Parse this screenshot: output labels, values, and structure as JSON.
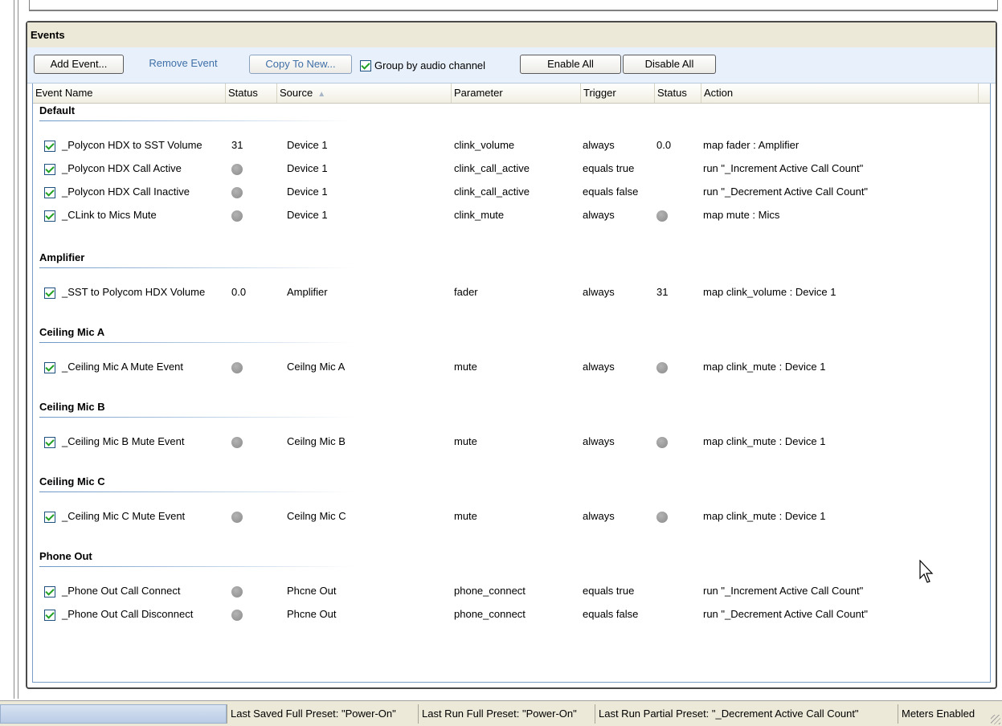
{
  "panel": {
    "title": "Events"
  },
  "toolbar": {
    "add_event": "Add Event...",
    "remove_event": "Remove Event",
    "copy_to_new": "Copy To New...",
    "group_by_audio_channel": "Group by audio channel",
    "enable_all": "Enable All",
    "disable_all": "Disable All"
  },
  "columns": {
    "event_name": "Event Name",
    "status": "Status",
    "source": "Source",
    "parameter": "Parameter",
    "trigger": "Trigger",
    "status2": "Status",
    "action": "Action"
  },
  "groups": [
    {
      "name": "Default",
      "rows": [
        {
          "name": "_Polycon HDX to SST Volume",
          "status": "31",
          "source": "Device 1",
          "parameter": "clink_volume",
          "trigger": "always",
          "status2": "0.0",
          "action": "map fader : Amplifier"
        },
        {
          "name": "_Polycon HDX Call Active",
          "status": "dot",
          "source": "Device 1",
          "parameter": "clink_call_active",
          "trigger": "equals true",
          "status2": "",
          "action": "run \"_Increment Active Call Count\""
        },
        {
          "name": "_Polycon HDX Call Inactive",
          "status": "dot",
          "source": "Device 1",
          "parameter": "clink_call_active",
          "trigger": "equals false",
          "status2": "",
          "action": "run \"_Decrement Active Call Count\""
        },
        {
          "name": "_CLink to Mics Mute",
          "status": "dot",
          "source": "Device 1",
          "parameter": "clink_mute",
          "trigger": "always",
          "status2": "dot",
          "action": "map mute : Mics"
        }
      ]
    },
    {
      "name": "Amplifier",
      "rows": [
        {
          "name": "_SST to Polycom HDX Volume",
          "status": "0.0",
          "source": "Amplifier",
          "parameter": "fader",
          "trigger": "always",
          "status2": "31",
          "action": "map clink_volume : Device 1"
        }
      ]
    },
    {
      "name": "Ceiling Mic A",
      "rows": [
        {
          "name": "_Ceiling Mic A Mute Event",
          "status": "dot",
          "source": "Ceilng Mic A",
          "parameter": "mute",
          "trigger": "always",
          "status2": "dot",
          "action": "map clink_mute : Device 1"
        }
      ]
    },
    {
      "name": "Ceiling Mic B",
      "rows": [
        {
          "name": "_Ceiling Mic B Mute Event",
          "status": "dot",
          "source": "Ceilng Mic B",
          "parameter": "mute",
          "trigger": "always",
          "status2": "dot",
          "action": "map clink_mute : Device 1"
        }
      ]
    },
    {
      "name": "Ceiling Mic C",
      "rows": [
        {
          "name": "_Ceiling Mic C Mute Event",
          "status": "dot",
          "source": "Ceilng Mic C",
          "parameter": "mute",
          "trigger": "always",
          "status2": "dot",
          "action": "map clink_mute : Device 1"
        }
      ]
    },
    {
      "name": "Phone Out",
      "rows": [
        {
          "name": "_Phone Out Call Connect",
          "status": "dot",
          "source": "Phcne Out",
          "parameter": "phone_connect",
          "trigger": "equals true",
          "status2": "",
          "action": "run \"_Increment Active Call Count\""
        },
        {
          "name": "_Phone Out Call Disconnect",
          "status": "dot",
          "source": "Phcne Out",
          "parameter": "phone_connect",
          "trigger": "equals false",
          "status2": "",
          "action": "run \"_Decrement Active Call Count\""
        }
      ]
    }
  ],
  "statusbar": {
    "last_saved": "Last Saved Full Preset: \"Power-On\"",
    "last_run_full": "Last Run Full Preset: \"Power-On\"",
    "last_run_partial": "Last Run Partial Preset: \"_Decrement Active Call Count\"",
    "meters": "Meters Enabled"
  },
  "colors": {
    "accent": "#6a96c6",
    "toolbar_bg": "#e8f1fb",
    "status_dot": "#999999"
  }
}
